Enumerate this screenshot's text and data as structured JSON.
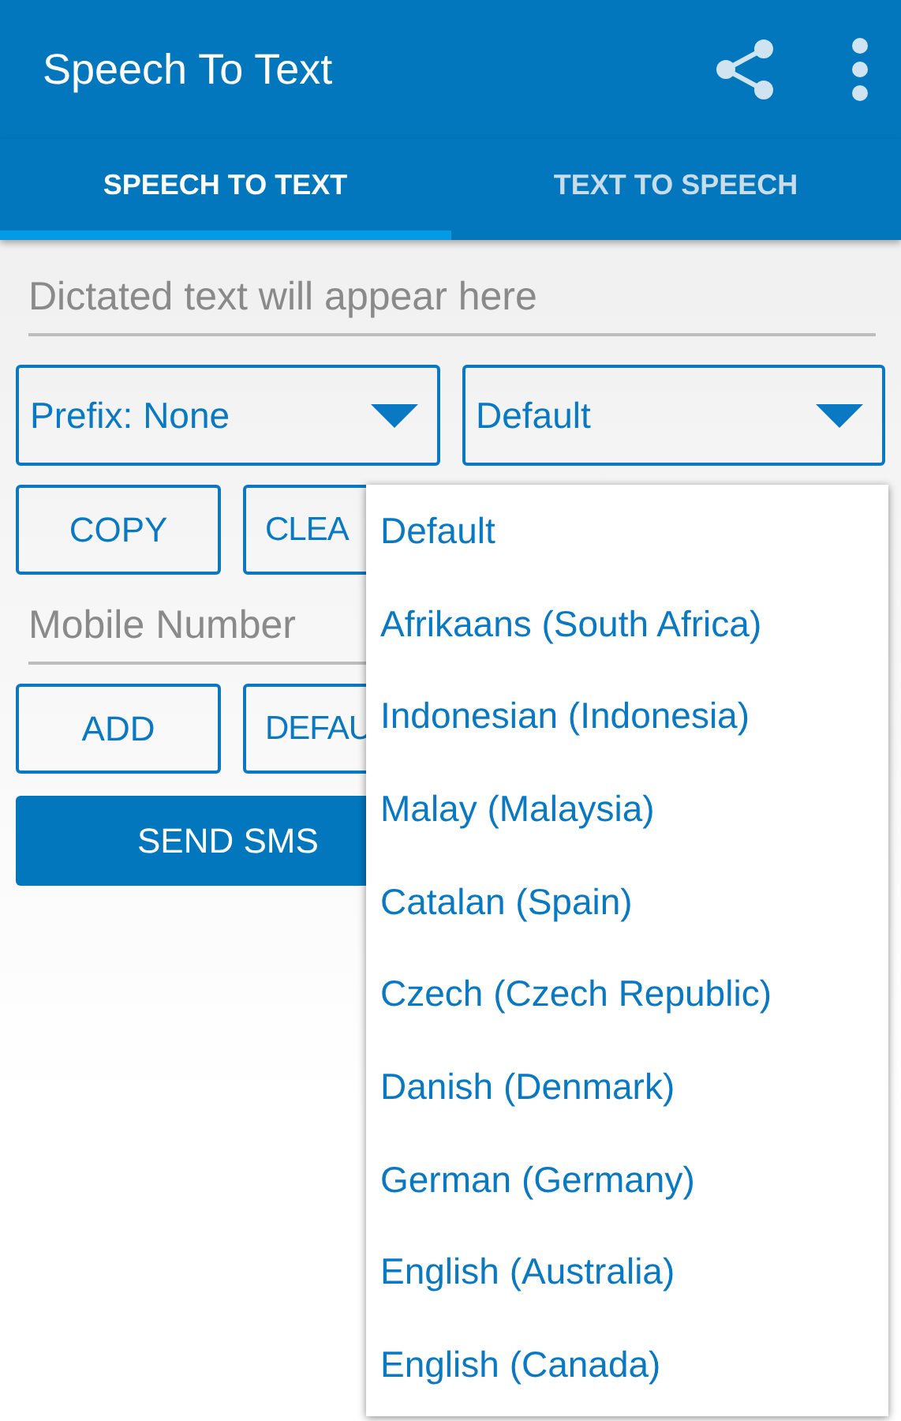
{
  "app_bar": {
    "title": "Speech To Text"
  },
  "tabs": [
    {
      "label": "SPEECH TO TEXT",
      "selected": true
    },
    {
      "label": "TEXT TO SPEECH",
      "selected": false
    }
  ],
  "dictation_field": {
    "placeholder": "Dictated text will appear here"
  },
  "spinners": [
    {
      "value": "Prefix: None"
    },
    {
      "value": "Default"
    }
  ],
  "text_buttons": [
    "COPY",
    "CLEA"
  ],
  "mobile_field": {
    "placeholder": "Mobile Number"
  },
  "number_buttons": [
    "ADD",
    "DEFAU"
  ],
  "send_button": "SEND SMS",
  "language_menu": [
    "Default",
    "Afrikaans (South Africa)",
    "Indonesian (Indonesia)",
    "Malay (Malaysia)",
    "Catalan (Spain)",
    "Czech (Czech Republic)",
    "Danish (Denmark)",
    "German (Germany)",
    "English (Australia)",
    "English (Canada)"
  ]
}
